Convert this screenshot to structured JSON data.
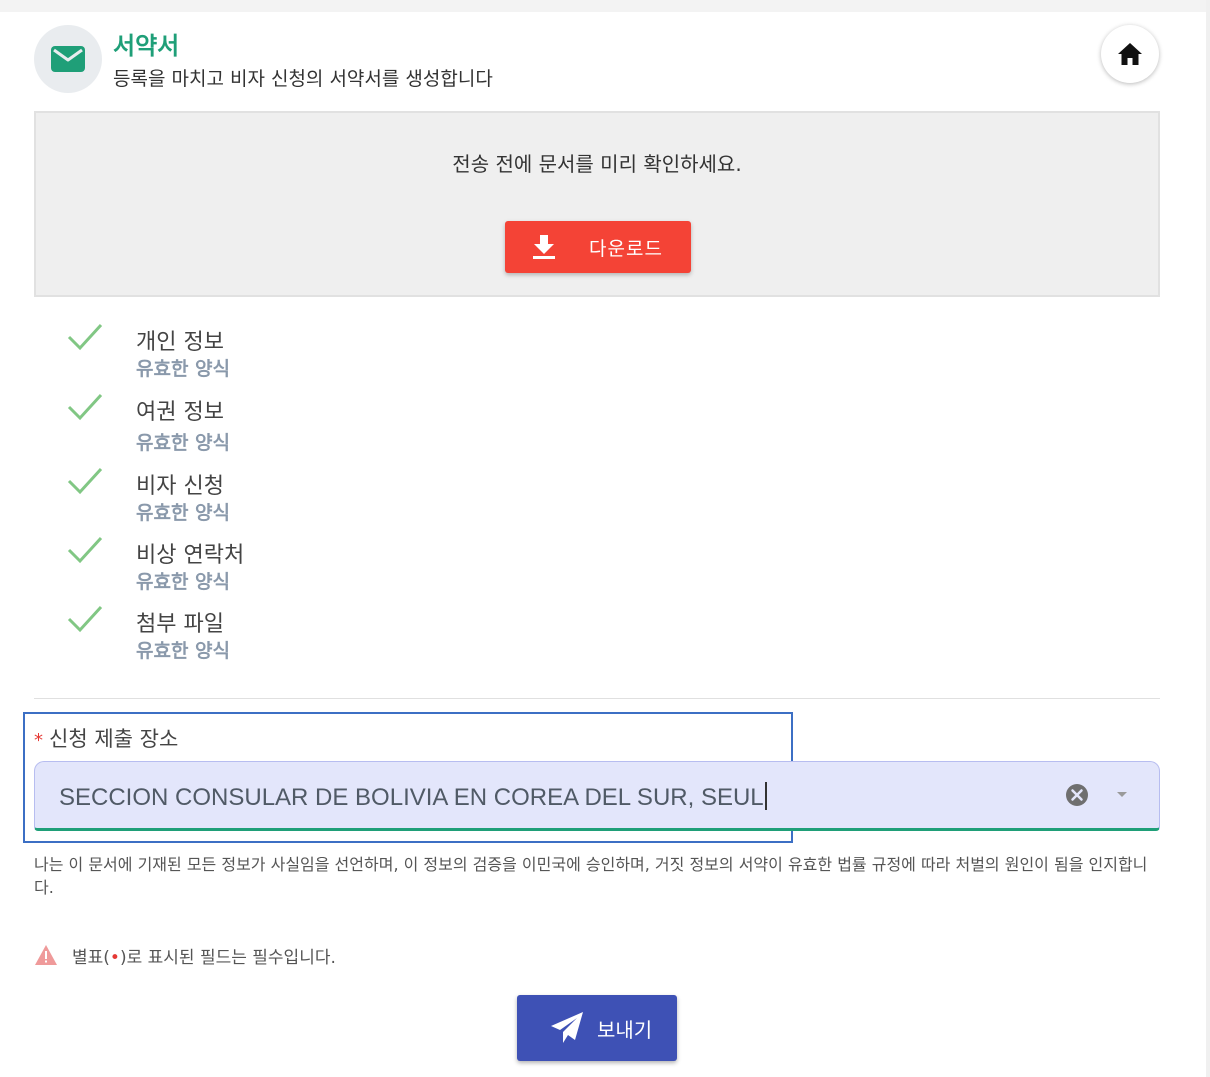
{
  "header": {
    "title": "서약서",
    "subtitle": "등록을 마치고 비자 신청의 서약서를 생성합니다",
    "icon": "envelope-icon",
    "home_icon": "home-icon"
  },
  "preview": {
    "text": "전송 전에 문서를 미리 확인하세요.",
    "download_label": "다운로드",
    "download_icon": "download-icon"
  },
  "checklist": [
    {
      "title": "개인 정보",
      "status": "유효한 양식"
    },
    {
      "title": "여권 정보",
      "status": "유효한 양식"
    },
    {
      "title": "비자 신청",
      "status": "유효한 양식"
    },
    {
      "title": "비상 연락처",
      "status": "유효한 양식"
    },
    {
      "title": "첨부 파일",
      "status": "유효한 양식"
    }
  ],
  "location": {
    "required_mark": "*",
    "label": "신청 제출 장소",
    "value": "SECCION CONSULAR DE BOLIVIA EN COREA DEL SUR, SEUL"
  },
  "declaration": "나는 이 문서에 기재된 모든 정보가 사실임을 선언하며, 이 정보의 검증을 이민국에 승인하며, 거짓 정보의 서약이 유효한 법률 규정에 따라 처벌의 원인이 됨을 인지합니다.",
  "notice": {
    "prefix": "별표(",
    "dot": "•",
    "suffix": ")로 표시된 필드는 필수입니다."
  },
  "send_label": "보내기",
  "colors": {
    "accent_green": "#1f9f78",
    "download_red": "#f44336",
    "send_blue": "#3e51b5",
    "check_green": "#81c784",
    "required_red": "#e53935"
  }
}
